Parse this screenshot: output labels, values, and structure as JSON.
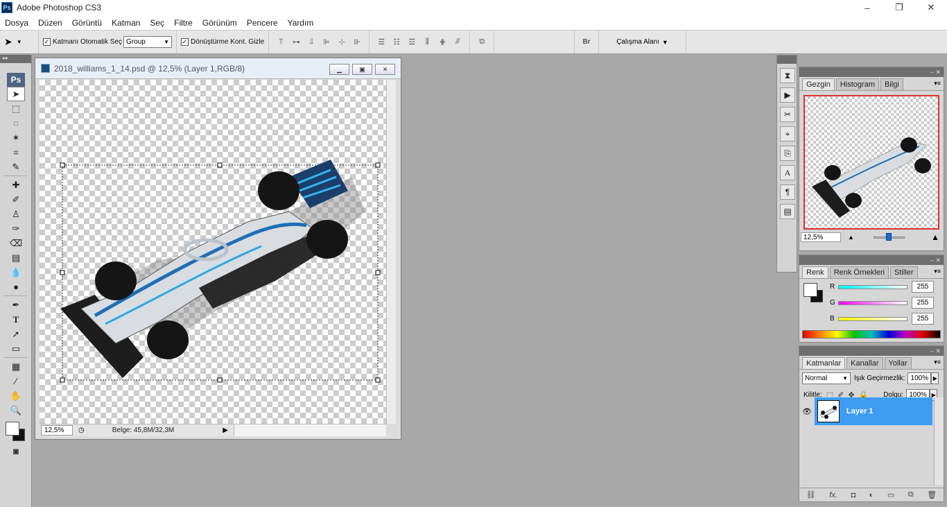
{
  "app": {
    "icon": "Ps",
    "title": "Adobe Photoshop CS3",
    "controls": [
      "–",
      "❐",
      "✕"
    ]
  },
  "menu": [
    "Dosya",
    "Düzen",
    "Görüntü",
    "Katman",
    "Seç",
    "Filtre",
    "Görünüm",
    "Pencere",
    "Yardım"
  ],
  "options": {
    "auto_select_label": "Katmanı Otomatik Seç",
    "auto_select_value": "Group",
    "transform_label": "Dönüştürme Kont. Gizle",
    "workspace": "Çalışma Alanı"
  },
  "document": {
    "title": "2018_williams_1_14.psd @ 12,5% (Layer 1,RGB/8)",
    "zoom": "12,5%",
    "doc_size": "Belge: 45,8M/32,3M"
  },
  "navigator": {
    "tabs": [
      "Gezgin",
      "Histogram",
      "Bilgi"
    ],
    "zoom": "12,5%",
    "zoom_level": 0.5
  },
  "color_panel": {
    "tabs": [
      "Renk",
      "Renk Örnekleri",
      "Stiller"
    ],
    "r_label": "R",
    "r_value": "255",
    "g_label": "G",
    "g_value": "255",
    "b_label": "B",
    "b_value": "255"
  },
  "layers_panel": {
    "tabs": [
      "Katmanlar",
      "Kanallar",
      "Yollar"
    ],
    "blend_mode": "Normal",
    "opacity_label": "Işık Geçirmezlik:",
    "opacity": "100%",
    "lock_label": "Kilitle:",
    "fill_label": "Dolgu:",
    "fill": "100%",
    "layer_name": "Layer 1"
  },
  "colors": {
    "selection": "#3e9cf2",
    "accent_red": "#e03030"
  }
}
